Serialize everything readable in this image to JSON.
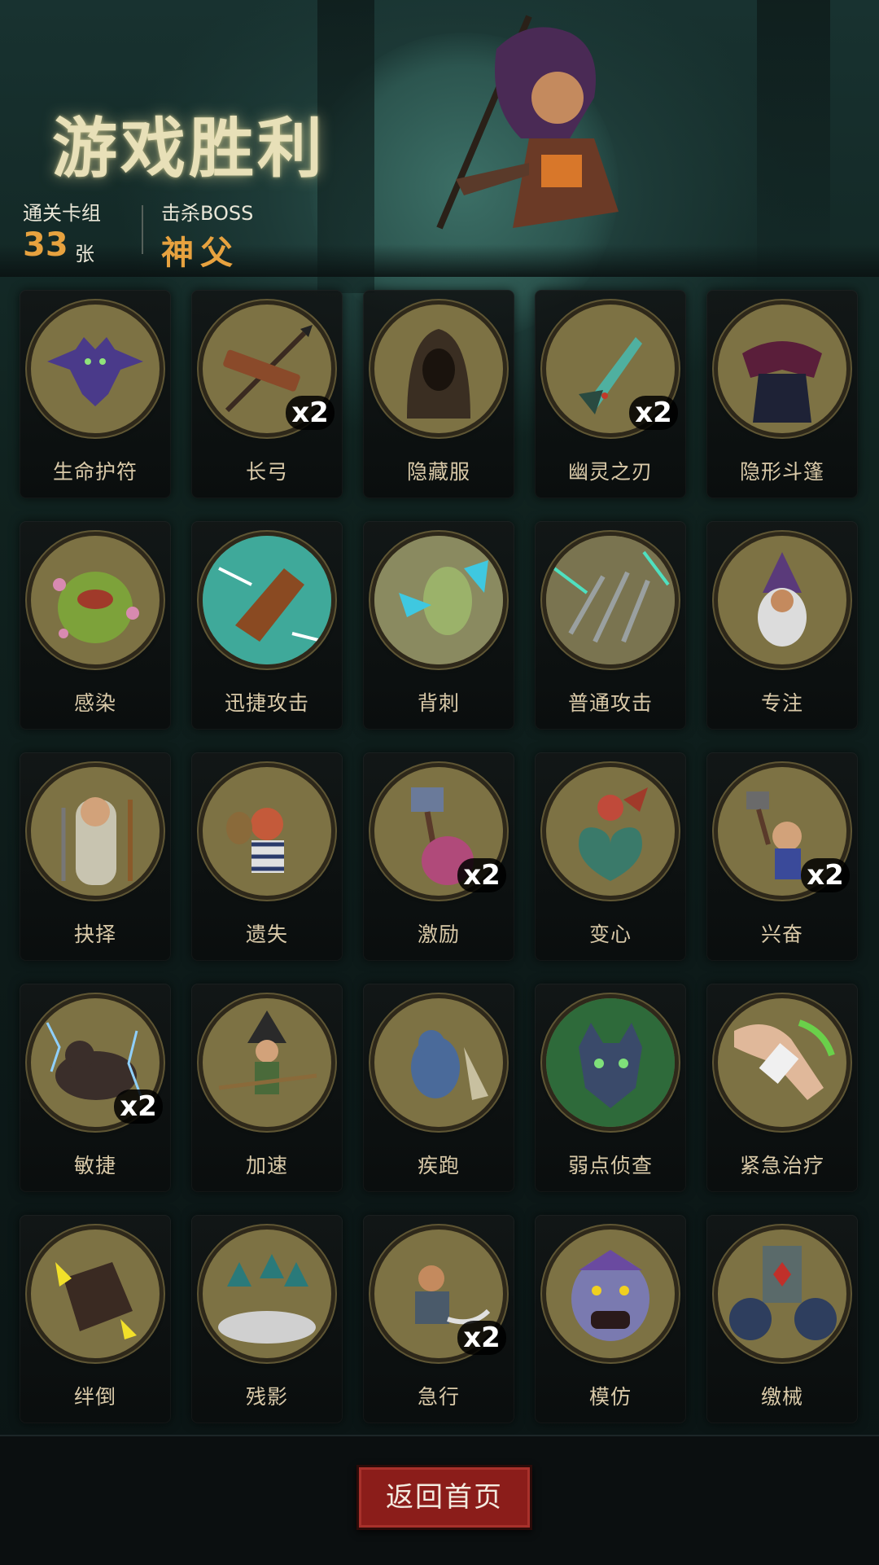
{
  "header": {
    "title": "游戏胜利",
    "deck_label": "通关卡组",
    "deck_count": "33",
    "deck_unit": "张",
    "boss_label": "击杀BOSS",
    "boss_name": "神父"
  },
  "cards": [
    {
      "name": "生命护符",
      "count": "",
      "icon": "bat-amulet-icon"
    },
    {
      "name": "长弓",
      "count": "x2",
      "icon": "longbow-icon"
    },
    {
      "name": "隐藏服",
      "count": "",
      "icon": "hooded-cloak-icon"
    },
    {
      "name": "幽灵之刃",
      "count": "x2",
      "icon": "ghost-dagger-icon"
    },
    {
      "name": "隐形斗篷",
      "count": "",
      "icon": "invisible-cape-icon"
    },
    {
      "name": "感染",
      "count": "",
      "icon": "infected-monster-icon"
    },
    {
      "name": "迅捷攻击",
      "count": "",
      "icon": "swift-strike-icon"
    },
    {
      "name": "背刺",
      "count": "",
      "icon": "backstab-icon"
    },
    {
      "name": "普通攻击",
      "count": "",
      "icon": "arrow-volley-icon"
    },
    {
      "name": "专注",
      "count": "",
      "icon": "wizard-focus-icon"
    },
    {
      "name": "抉择",
      "count": "",
      "icon": "sage-choice-icon"
    },
    {
      "name": "遗失",
      "count": "",
      "icon": "thief-icon"
    },
    {
      "name": "激励",
      "count": "x2",
      "icon": "hammer-brute-icon"
    },
    {
      "name": "变心",
      "count": "",
      "icon": "imp-heart-icon"
    },
    {
      "name": "兴奋",
      "count": "x2",
      "icon": "dwarf-hammer-icon"
    },
    {
      "name": "敏捷",
      "count": "x2",
      "icon": "panther-icon"
    },
    {
      "name": "加速",
      "count": "",
      "icon": "witch-broom-icon"
    },
    {
      "name": "疾跑",
      "count": "",
      "icon": "running-beast-icon"
    },
    {
      "name": "弱点侦查",
      "count": "",
      "icon": "wolf-head-icon"
    },
    {
      "name": "紧急治疗",
      "count": "",
      "icon": "bandage-arm-icon"
    },
    {
      "name": "绊倒",
      "count": "",
      "icon": "trip-boot-icon"
    },
    {
      "name": "残影",
      "count": "",
      "icon": "shadow-clones-icon"
    },
    {
      "name": "急行",
      "count": "x2",
      "icon": "dashing-warrior-icon"
    },
    {
      "name": "模仿",
      "count": "",
      "icon": "troll-mimic-icon"
    },
    {
      "name": "缴械",
      "count": "",
      "icon": "disarm-banner-icon"
    }
  ],
  "footer": {
    "home_button": "返回首页"
  }
}
